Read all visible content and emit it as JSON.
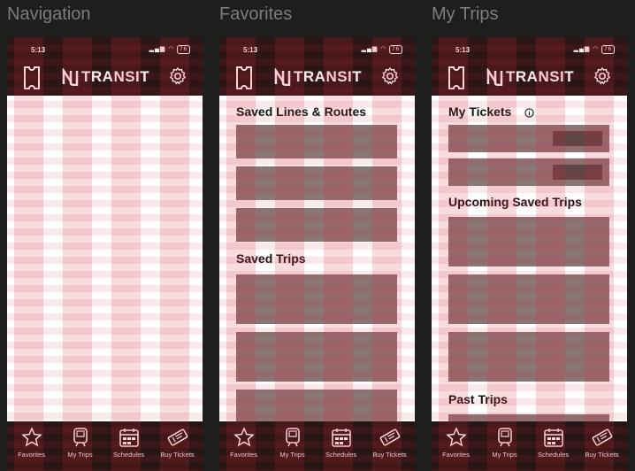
{
  "frames": [
    {
      "label": "Navigation",
      "status_time": "5:13",
      "battery": "76",
      "logo_text": "TRANSIT"
    },
    {
      "label": "Favorites",
      "status_time": "5:13",
      "battery": "76",
      "logo_text": "TRANSIT",
      "sections": [
        {
          "title": "Saved Lines & Routes"
        },
        {
          "title": "Saved Trips"
        }
      ]
    },
    {
      "label": "My Trips",
      "status_time": "5:13",
      "battery": "76",
      "logo_text": "TRANSIT",
      "sections": [
        {
          "title": "My Tickets"
        },
        {
          "title": "Upcoming Saved Trips"
        },
        {
          "title": "Past Trips"
        }
      ]
    }
  ],
  "tabbar": {
    "items": [
      {
        "label": "Favorites",
        "icon": "star-icon"
      },
      {
        "label": "My Trips",
        "icon": "train-icon"
      },
      {
        "label": "Schedules",
        "icon": "calendar-icon"
      },
      {
        "label": "Buy Tickets",
        "icon": "ticket-icon"
      }
    ]
  },
  "colors": {
    "header_bg": "#2b1517",
    "tabbar_bg": "#281516",
    "card_bg": "#8a7577",
    "grid_overlay": "#d22837"
  }
}
